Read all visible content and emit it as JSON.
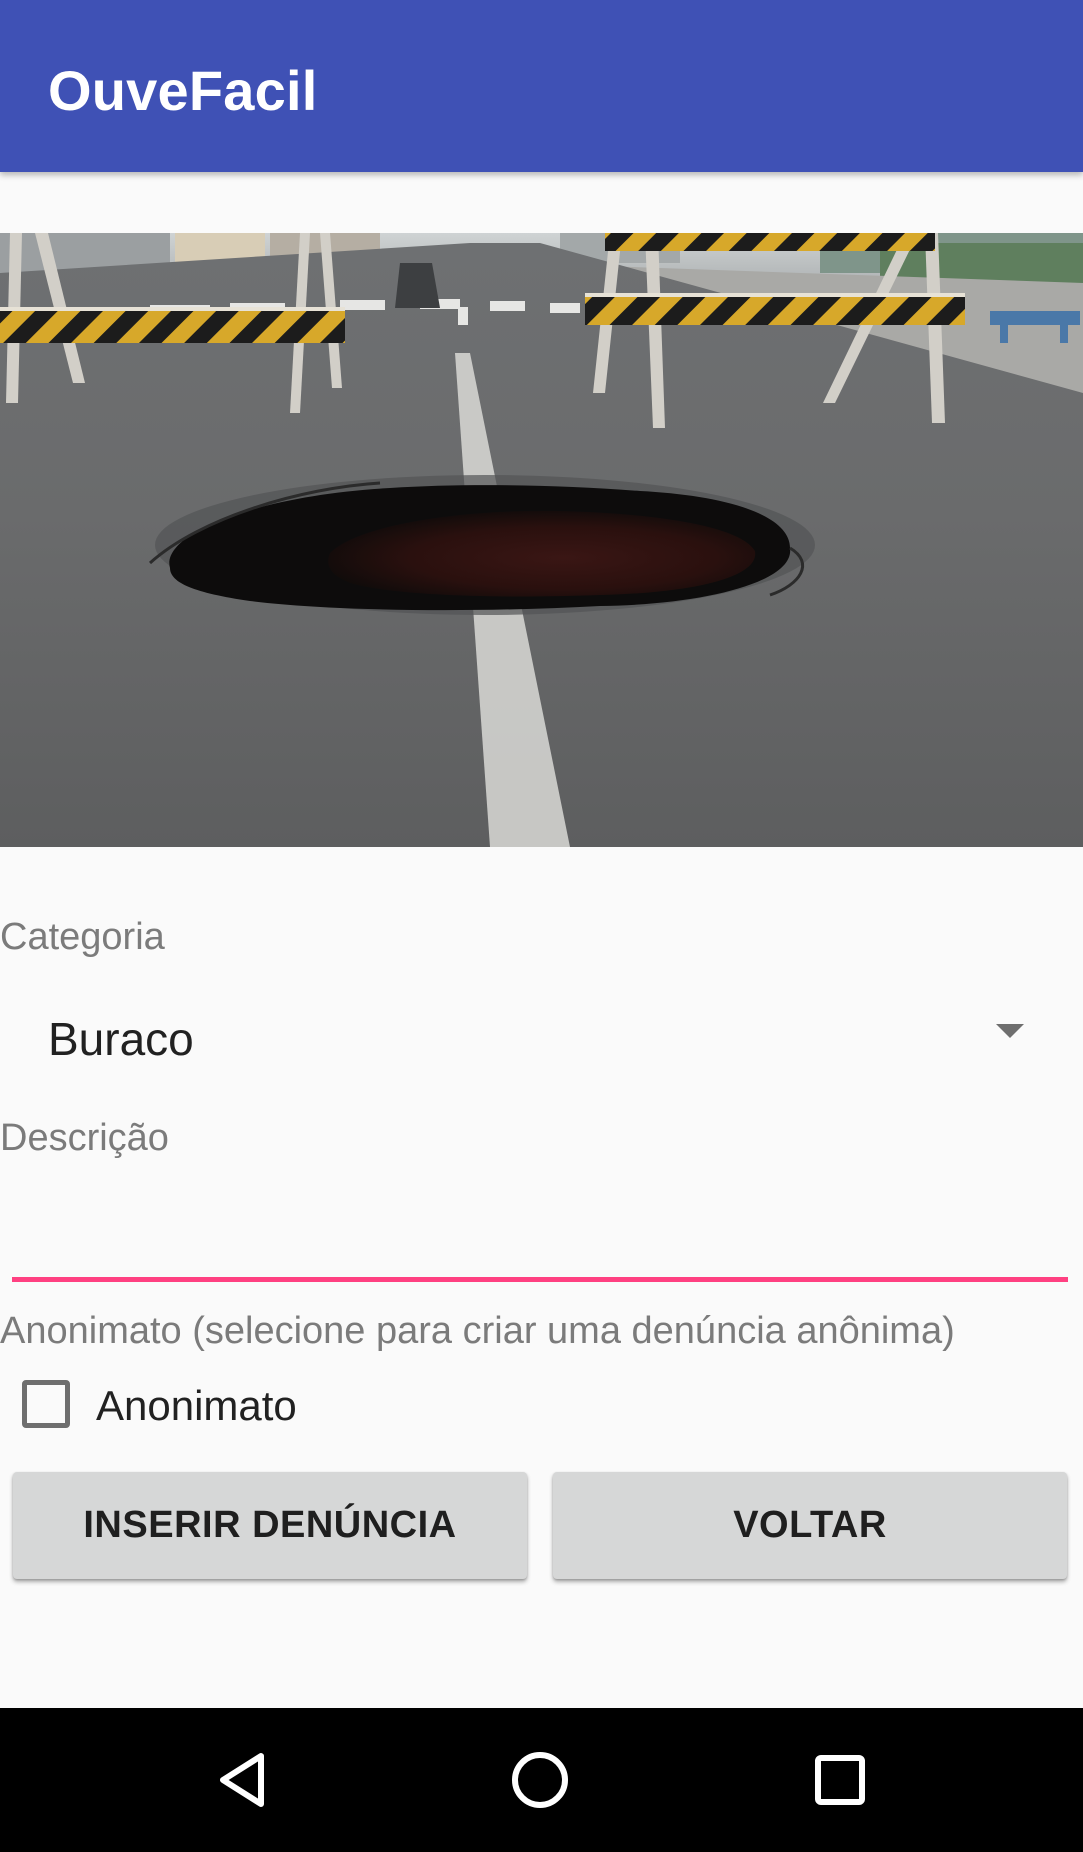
{
  "app_bar": {
    "title": "OuveFacil"
  },
  "photo": {
    "icon": "pothole-photo"
  },
  "form": {
    "categoria_label": "Categoria",
    "categoria_value": "Buraco",
    "descricao_label": "Descrição",
    "descricao_value": "",
    "anonimato_label": "Anonimato (selecione para criar uma denúncia anônima)",
    "anonimato_checkbox_label": "Anonimato",
    "anonimato_checked": false
  },
  "buttons": {
    "insert_label": "INSERIR DENÚNCIA",
    "back_label": "VOLTAR"
  },
  "colors": {
    "app_bar": "#3f51b5",
    "accent": "#ff4081",
    "button": "#d6d7d7"
  },
  "system_nav": {
    "back": "back-triangle-icon",
    "home": "home-circle-icon",
    "recents": "recents-square-icon"
  }
}
